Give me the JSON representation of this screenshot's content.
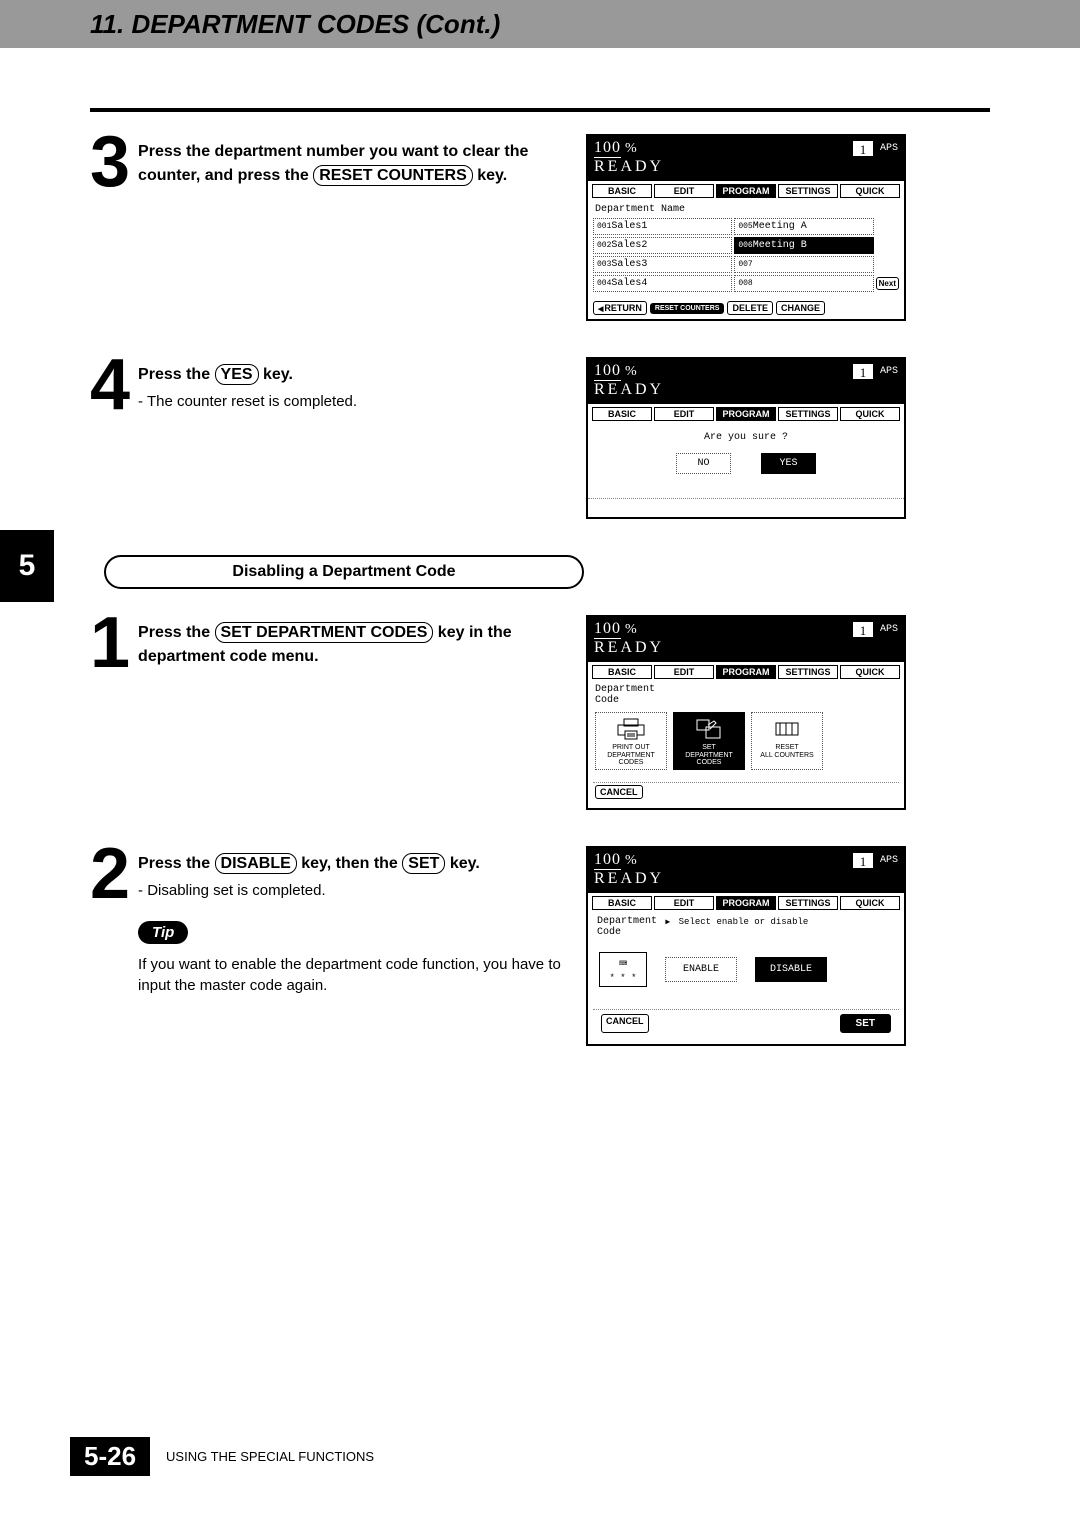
{
  "header": {
    "title": "11. DEPARTMENT CODES (Cont.)"
  },
  "chapter_tab": "5",
  "steps_a": {
    "s3": {
      "num": "3",
      "text_a": "Press the department number you want to clear the counter, and press the ",
      "key": "RESET COUNTERS",
      "text_b": " key."
    },
    "s4": {
      "num": "4",
      "text_a": "Press the ",
      "key": "YES",
      "text_b": " key.",
      "sub": "- The counter reset is completed."
    }
  },
  "section_b_title": "Disabling a Department Code",
  "steps_b": {
    "s1": {
      "num": "1",
      "text_a": "Press the ",
      "key": "SET DEPARTMENT CODES",
      "text_b": " key in the department code menu."
    },
    "s2": {
      "num": "2",
      "text_a": "Press the ",
      "key1": "DISABLE",
      "text_mid": " key, then the ",
      "key2": "SET",
      "text_b": " key.",
      "sub": "- Disabling set is completed."
    }
  },
  "tip": {
    "label": "Tip",
    "text": "If you want to enable the department code function, you have to input the master code again."
  },
  "footer": {
    "page": "5-26",
    "caption": "USING THE SPECIAL FUNCTIONS"
  },
  "screen_common": {
    "zoom": "100",
    "pct": "%",
    "count": "1",
    "aps": "APS",
    "ready": "READY",
    "tabs": {
      "basic": "BASIC",
      "edit": "EDIT",
      "program": "PROGRAM",
      "settings": "SETTINGS",
      "quick": "QUICK"
    }
  },
  "screen3": {
    "heading": "Department Name",
    "rows": [
      {
        "l_id": "001",
        "l": "Sales1",
        "r_id": "005",
        "r": "Meeting A"
      },
      {
        "l_id": "002",
        "l": "Sales2",
        "r_id": "006",
        "r": "Meeting B",
        "r_sel": true
      },
      {
        "l_id": "003",
        "l": "Sales3",
        "r_id": "007",
        "r": ""
      },
      {
        "l_id": "004",
        "l": "Sales4",
        "r_id": "008",
        "r": ""
      }
    ],
    "next": "Next",
    "bottom": {
      "return": "RETURN",
      "reset": "RESET COUNTERS",
      "delete": "DELETE",
      "change": "CHANGE"
    }
  },
  "screen4": {
    "msg": "Are you sure ?",
    "no": "NO",
    "yes": "YES"
  },
  "screen_b1": {
    "heading": "Department\nCode",
    "items": {
      "print": "PRINT OUT\nDEPARTMENT CODES",
      "set": "SET\nDEPARTMENT CODES",
      "reset": "RESET\nALL COUNTERS"
    },
    "cancel": "CANCEL"
  },
  "screen_b2": {
    "heading": "Department\nCode",
    "hint": "Select enable or disable",
    "keypad": "* * *",
    "enable": "ENABLE",
    "disable": "DISABLE",
    "cancel": "CANCEL",
    "set": "SET"
  }
}
